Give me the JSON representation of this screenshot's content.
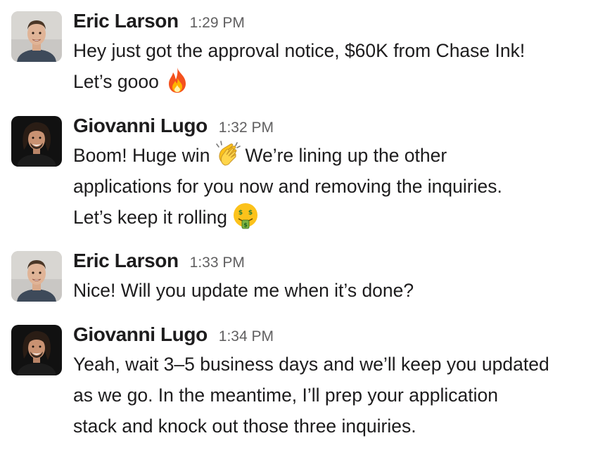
{
  "messages": [
    {
      "sender": "Eric Larson",
      "time": "1:29 PM",
      "avatar": "eric-avatar",
      "lines": [
        {
          "text": "Hey just got the approval notice, $60K from Chase Ink!"
        },
        {
          "text": "Let’s gooo",
          "emoji": "fire-emoji"
        }
      ]
    },
    {
      "sender": "Giovanni Lugo",
      "time": "1:32 PM",
      "avatar": "giovanni-avatar",
      "lines": [
        {
          "text": "Boom! Huge win",
          "emoji": "clapping-hands-emoji",
          "after": "We’re lining up the other"
        },
        {
          "text": "applications for you now and removing the inquiries."
        },
        {
          "text": "Let’s keep it rolling",
          "emoji": "money-mouth-face-emoji"
        }
      ]
    },
    {
      "sender": "Eric Larson",
      "time": "1:33 PM",
      "avatar": "eric-avatar",
      "lines": [
        {
          "text": "Nice! Will you update me when it’s done?"
        }
      ]
    },
    {
      "sender": "Giovanni Lugo",
      "time": "1:34 PM",
      "avatar": "giovanni-avatar",
      "lines": [
        {
          "text": "Yeah, wait 3–5 business days and we’ll keep you updated"
        },
        {
          "text": "as we go. In the meantime, I’ll prep your application"
        },
        {
          "text": "stack and knock out those three inquiries."
        }
      ]
    }
  ]
}
